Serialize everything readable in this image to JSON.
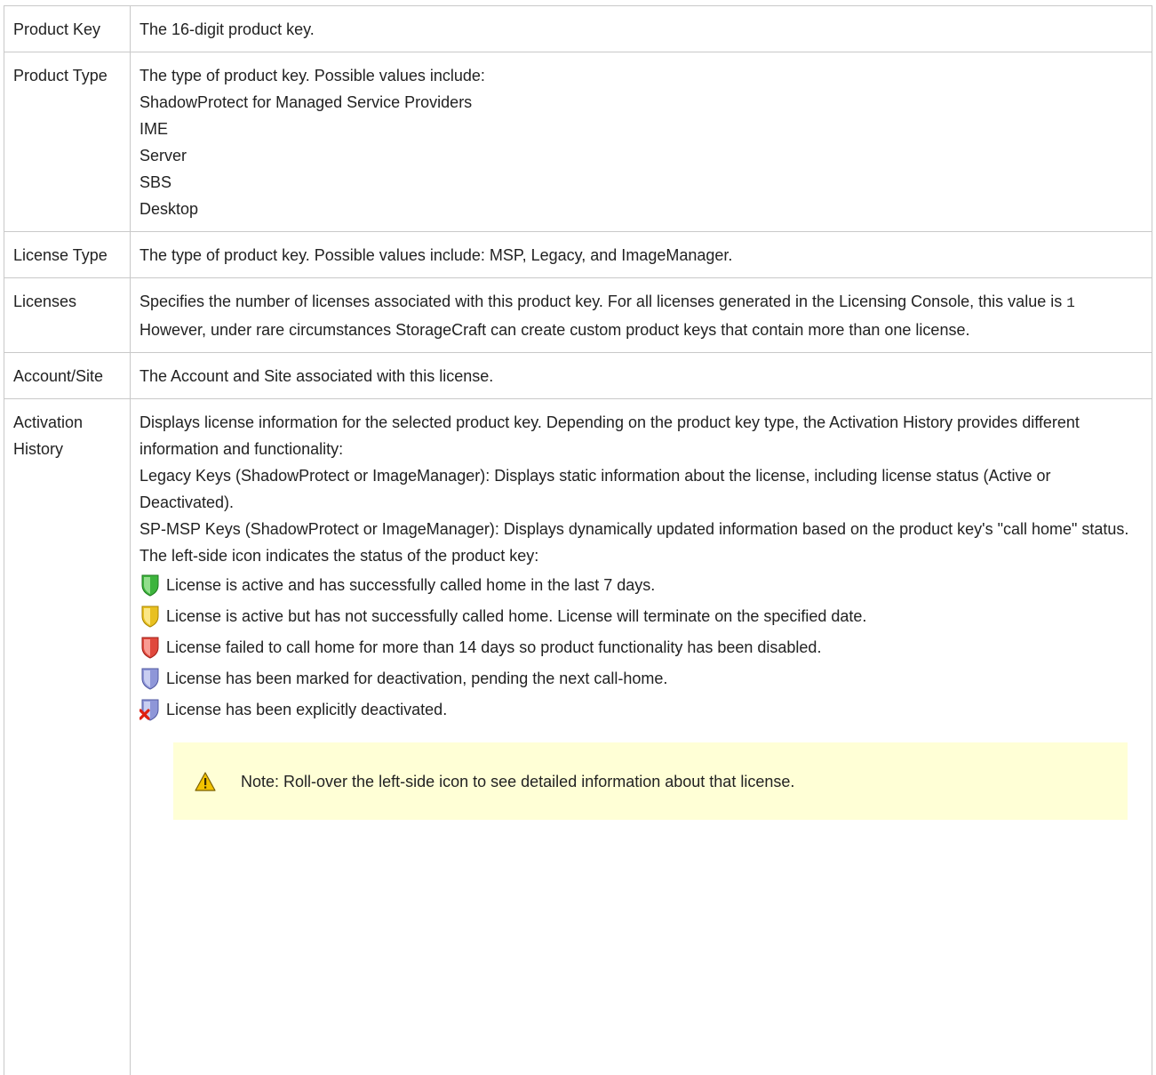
{
  "rows": [
    {
      "term": "Product Key",
      "desc": "The 16-digit product key."
    },
    {
      "term": "Product Type",
      "desc_lines": [
        "The type of product key. Possible values include:",
        "ShadowProtect for Managed Service Providers",
        "IME",
        "Server",
        "SBS",
        "Desktop"
      ]
    },
    {
      "term": "License Type",
      "desc": "The type of product key. Possible values include: MSP, Legacy, and ImageManager."
    },
    {
      "term": "Licenses",
      "desc_pre": "Specifies the number of licenses associated with this product key. For all licenses generated in the Licensing Console, this value is ",
      "desc_code": "1",
      "desc_post": " However, under rare circumstances StorageCraft can create custom product keys that contain more than one license."
    },
    {
      "term": "Account/Site",
      "desc": "The Account and Site associated with this license."
    },
    {
      "term": "Activation History",
      "desc_lines": [
        "Displays license information for the selected product key. Depending on the product key type, the Activation History provides different information and functionality:",
        "Legacy Keys (ShadowProtect or ImageManager): Displays static information about the license, including license status (Active or Deactivated).",
        "SP-MSP Keys (ShadowProtect or ImageManager): Displays dynamically updated information based on the product key's \"call home\" status. The left-side icon indicates the status of the product key:"
      ],
      "statuses": [
        {
          "icon": "green-shield-icon",
          "color": "#3cb43c",
          "text": "License is active and has successfully called home in the last 7 days."
        },
        {
          "icon": "yellow-shield-icon",
          "color": "#e8c020",
          "text": "License is active but has not successfully called home. License will terminate on the specified date."
        },
        {
          "icon": "red-shield-icon",
          "color": "#e0483c",
          "text": "License failed to call home for more than 14 days so product functionality has been disabled."
        },
        {
          "icon": "blue-shield-icon",
          "color": "#8e96d8",
          "text": "License has been marked for deactivation, pending the next call-home."
        },
        {
          "icon": "deactivated-shield-icon",
          "color": "#8e96d8",
          "text": "License has been explicitly deactivated."
        }
      ],
      "note": "Note: Roll-over the left-side icon to see detailed information about that license."
    }
  ]
}
